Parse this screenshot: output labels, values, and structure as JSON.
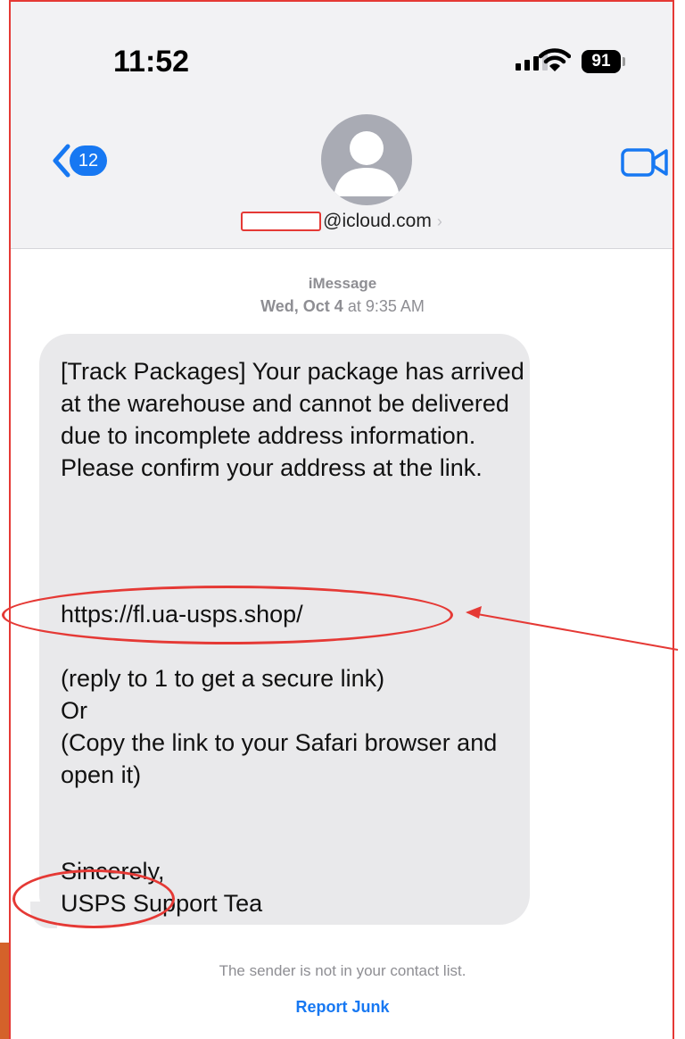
{
  "status_bar": {
    "time": "11:52",
    "battery_level": "91"
  },
  "nav": {
    "unread_count": "12",
    "contact_domain": "@icloud.com",
    "contact_chevron": "›"
  },
  "conversation": {
    "service": "iMessage",
    "date_day": "Wed, Oct 4",
    "date_time": " at 9:35 AM"
  },
  "message": {
    "body": "[Track Packages] Your package has arrived at the warehouse and cannot be delivered due to incomplete address information. Please confirm your address at the link.",
    "link": "https://fl.ua-usps.shop/",
    "reply_instructions": "(reply to 1 to get a secure link)\nOr\n(Copy the link to your Safari browser and open it)",
    "signoff": "Sincerely,\nUSPS Support Tea"
  },
  "footer": {
    "sender_notice": "The sender is not in your contact list.",
    "report_junk": "Report Junk"
  },
  "colors": {
    "accent": "#1778f2",
    "annotation": "#e53935",
    "bubble": "#e9e9eb"
  }
}
